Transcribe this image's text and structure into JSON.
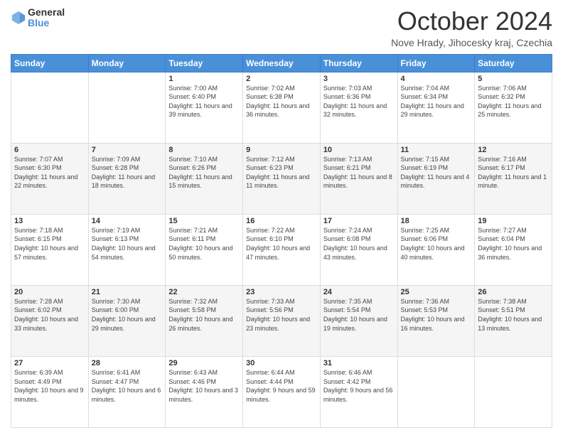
{
  "header": {
    "logo": {
      "general": "General",
      "blue": "Blue"
    },
    "title": "October 2024",
    "location": "Nove Hrady, Jihocesky kraj, Czechia"
  },
  "calendar": {
    "days_of_week": [
      "Sunday",
      "Monday",
      "Tuesday",
      "Wednesday",
      "Thursday",
      "Friday",
      "Saturday"
    ],
    "weeks": [
      [
        {
          "day": "",
          "info": ""
        },
        {
          "day": "",
          "info": ""
        },
        {
          "day": "1",
          "info": "Sunrise: 7:00 AM\nSunset: 6:40 PM\nDaylight: 11 hours and 39 minutes."
        },
        {
          "day": "2",
          "info": "Sunrise: 7:02 AM\nSunset: 6:38 PM\nDaylight: 11 hours and 36 minutes."
        },
        {
          "day": "3",
          "info": "Sunrise: 7:03 AM\nSunset: 6:36 PM\nDaylight: 11 hours and 32 minutes."
        },
        {
          "day": "4",
          "info": "Sunrise: 7:04 AM\nSunset: 6:34 PM\nDaylight: 11 hours and 29 minutes."
        },
        {
          "day": "5",
          "info": "Sunrise: 7:06 AM\nSunset: 6:32 PM\nDaylight: 11 hours and 25 minutes."
        }
      ],
      [
        {
          "day": "6",
          "info": "Sunrise: 7:07 AM\nSunset: 6:30 PM\nDaylight: 11 hours and 22 minutes."
        },
        {
          "day": "7",
          "info": "Sunrise: 7:09 AM\nSunset: 6:28 PM\nDaylight: 11 hours and 18 minutes."
        },
        {
          "day": "8",
          "info": "Sunrise: 7:10 AM\nSunset: 6:26 PM\nDaylight: 11 hours and 15 minutes."
        },
        {
          "day": "9",
          "info": "Sunrise: 7:12 AM\nSunset: 6:23 PM\nDaylight: 11 hours and 11 minutes."
        },
        {
          "day": "10",
          "info": "Sunrise: 7:13 AM\nSunset: 6:21 PM\nDaylight: 11 hours and 8 minutes."
        },
        {
          "day": "11",
          "info": "Sunrise: 7:15 AM\nSunset: 6:19 PM\nDaylight: 11 hours and 4 minutes."
        },
        {
          "day": "12",
          "info": "Sunrise: 7:16 AM\nSunset: 6:17 PM\nDaylight: 11 hours and 1 minute."
        }
      ],
      [
        {
          "day": "13",
          "info": "Sunrise: 7:18 AM\nSunset: 6:15 PM\nDaylight: 10 hours and 57 minutes."
        },
        {
          "day": "14",
          "info": "Sunrise: 7:19 AM\nSunset: 6:13 PM\nDaylight: 10 hours and 54 minutes."
        },
        {
          "day": "15",
          "info": "Sunrise: 7:21 AM\nSunset: 6:11 PM\nDaylight: 10 hours and 50 minutes."
        },
        {
          "day": "16",
          "info": "Sunrise: 7:22 AM\nSunset: 6:10 PM\nDaylight: 10 hours and 47 minutes."
        },
        {
          "day": "17",
          "info": "Sunrise: 7:24 AM\nSunset: 6:08 PM\nDaylight: 10 hours and 43 minutes."
        },
        {
          "day": "18",
          "info": "Sunrise: 7:25 AM\nSunset: 6:06 PM\nDaylight: 10 hours and 40 minutes."
        },
        {
          "day": "19",
          "info": "Sunrise: 7:27 AM\nSunset: 6:04 PM\nDaylight: 10 hours and 36 minutes."
        }
      ],
      [
        {
          "day": "20",
          "info": "Sunrise: 7:28 AM\nSunset: 6:02 PM\nDaylight: 10 hours and 33 minutes."
        },
        {
          "day": "21",
          "info": "Sunrise: 7:30 AM\nSunset: 6:00 PM\nDaylight: 10 hours and 29 minutes."
        },
        {
          "day": "22",
          "info": "Sunrise: 7:32 AM\nSunset: 5:58 PM\nDaylight: 10 hours and 26 minutes."
        },
        {
          "day": "23",
          "info": "Sunrise: 7:33 AM\nSunset: 5:56 PM\nDaylight: 10 hours and 23 minutes."
        },
        {
          "day": "24",
          "info": "Sunrise: 7:35 AM\nSunset: 5:54 PM\nDaylight: 10 hours and 19 minutes."
        },
        {
          "day": "25",
          "info": "Sunrise: 7:36 AM\nSunset: 5:53 PM\nDaylight: 10 hours and 16 minutes."
        },
        {
          "day": "26",
          "info": "Sunrise: 7:38 AM\nSunset: 5:51 PM\nDaylight: 10 hours and 13 minutes."
        }
      ],
      [
        {
          "day": "27",
          "info": "Sunrise: 6:39 AM\nSunset: 4:49 PM\nDaylight: 10 hours and 9 minutes."
        },
        {
          "day": "28",
          "info": "Sunrise: 6:41 AM\nSunset: 4:47 PM\nDaylight: 10 hours and 6 minutes."
        },
        {
          "day": "29",
          "info": "Sunrise: 6:43 AM\nSunset: 4:46 PM\nDaylight: 10 hours and 3 minutes."
        },
        {
          "day": "30",
          "info": "Sunrise: 6:44 AM\nSunset: 4:44 PM\nDaylight: 9 hours and 59 minutes."
        },
        {
          "day": "31",
          "info": "Sunrise: 6:46 AM\nSunset: 4:42 PM\nDaylight: 9 hours and 56 minutes."
        },
        {
          "day": "",
          "info": ""
        },
        {
          "day": "",
          "info": ""
        }
      ]
    ]
  }
}
